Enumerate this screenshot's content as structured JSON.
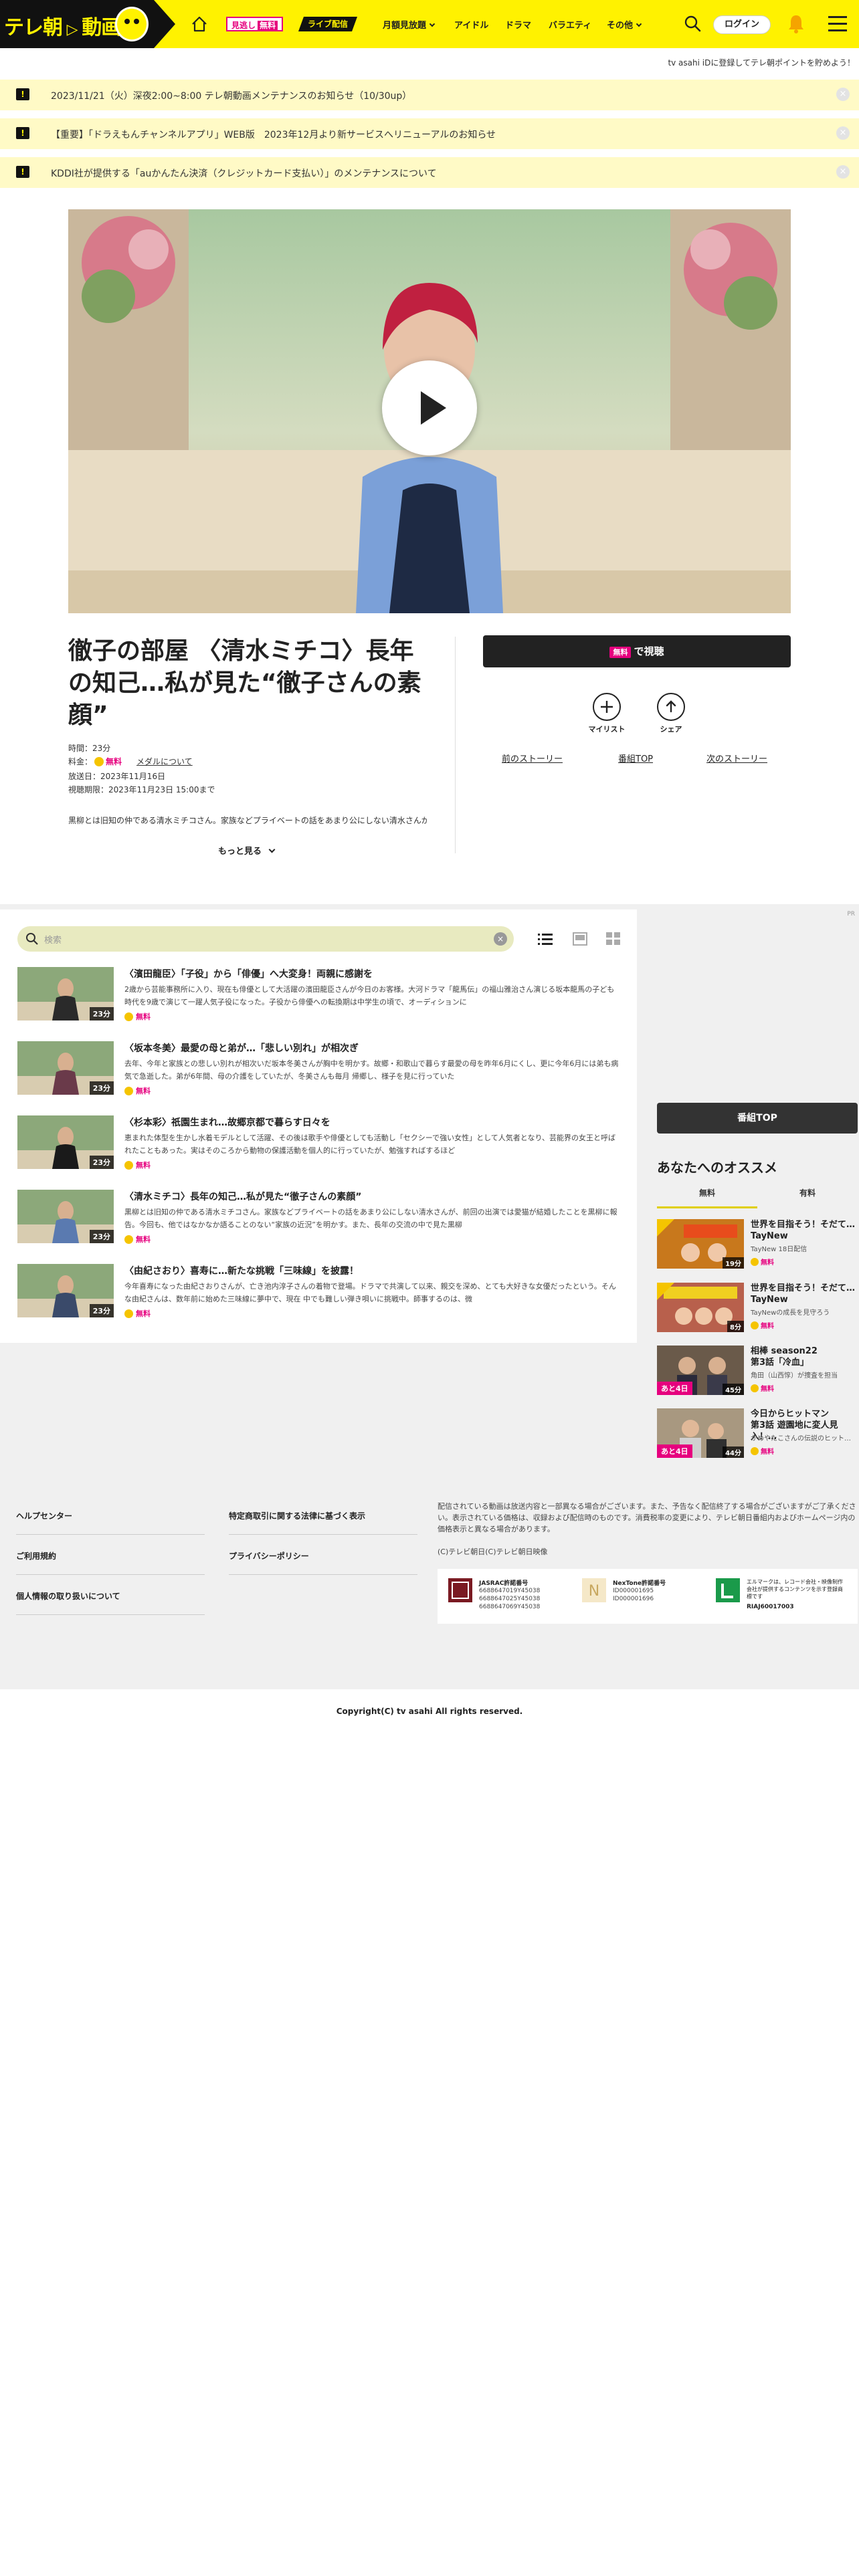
{
  "header": {
    "logo_text": "テレ朝",
    "logo_text2": "動画",
    "badge_mikoshi": "見逃し",
    "badge_free": "無料",
    "badge_live": "ライブ配信",
    "nav": [
      {
        "label": "月額見放題",
        "dropdown": true
      },
      {
        "label": "アイドル",
        "dropdown": false
      },
      {
        "label": "ドラマ",
        "dropdown": false
      },
      {
        "label": "バラエティ",
        "dropdown": false
      },
      {
        "label": "その他",
        "dropdown": true
      }
    ],
    "login_label": "ログイン",
    "brand_yellow": "#fff200"
  },
  "promo_text": "tv asahi iDに登録してテレ朝ポイントを貯めよう！",
  "notices": [
    {
      "icon": "!",
      "text": "2023/11/21（火）深夜2:00~8:00 テレ朝動画メンテナンスのお知らせ（10/30up）",
      "close": "×"
    },
    {
      "icon": "!",
      "text": "【重要】「ドラえもんチャンネルアプリ」WEB版　2023年12月より新サービスへリニューアルのお知らせ",
      "close": "×"
    },
    {
      "icon": "!",
      "text": "KDDI社が提供する「auかんたん決済（クレジットカード支払い）」のメンテナンスについて",
      "close": "×"
    }
  ],
  "episode": {
    "title": "徹子の部屋 〈清水ミチコ〉長年の知己…私が見た“徹子さんの素顔”",
    "time": "時間：23分",
    "price_prefix": "料金：",
    "price_free": "無料",
    "medal_link": "メダルについて",
    "aired": "放送日：2023年11月16日",
    "expires": "視聴期限：2023年11月23日 15:00まで",
    "synopsis": "黒柳とは旧知の仲である清水ミチコさん。家族などプライベートの話をあまり公にしない清水さんが、前回の出演では愛猫が結婚したことを黒柳に報告。",
    "more_label": "もっと見る",
    "watch_tag": "無料",
    "watch_label": "で視聴",
    "mylist_label": "マイリスト",
    "share_label": "シェア",
    "prev_story": "前のストーリー",
    "program_top": "番組TOP",
    "next_story": "次のストーリー"
  },
  "list": {
    "search_placeholder": "検索",
    "items": [
      {
        "title": "〈濱田龍臣〉「子役」から「俳優」へ大変身！両親に感謝を",
        "desc": "2歳から芸能事務所に入り、現在も俳優として大活躍の濱田龍臣さんが今日のお客様。大河ドラマ「龍馬伝」の福山雅治さん演じる坂本龍馬の子ども時代を9歳で演じて一躍人気子役になった。子役から俳優への転換期は中学生の頃で、オーディションに",
        "free": "無料",
        "duration": "23分"
      },
      {
        "title": "〈坂本冬美〉最愛の母と弟が…「悲しい別れ」が相次ぎ",
        "desc": "去年、今年と家族との悲しい別れが相次いだ坂本冬美さんが胸中を明かす。故郷・和歌山で暮らす最愛の母を昨年6月にくし、更に今年6月には弟も病気で急逝した。弟が6年間、母の介護をしていたが、冬美さんも毎月 帰郷し、様子を見に行っていた",
        "free": "無料",
        "duration": "23分"
      },
      {
        "title": "〈杉本彩〉祇園生まれ…故郷京都で暮らす日々を",
        "desc": "恵まれた体型を生かし水着モデルとして活躍、その後は歌手や俳優としても活動し「セクシーで強い女性」として人気者となり、芸能界の女王と呼ばれたこともあった。実はそのころから動物の保護活動を個人的に行っていたが、勉強すればするほど",
        "free": "無料",
        "duration": "23分"
      },
      {
        "title": "〈清水ミチコ〉長年の知己…私が見た“徹子さんの素顔”",
        "desc": "黒柳とは旧知の仲である清水ミチコさん。家族などプライベートの話をあまり公にしない清水さんが、前回の出演では愛猫が結婚したことを黒柳に報告。今回も、他ではなかなか語ることのない“家族の近況”を明かす。また、長年の交流の中で見た黒柳",
        "free": "無料",
        "duration": "23分"
      },
      {
        "title": "〈由紀さおり〉喜寿に…新たな挑戦「三味線」を披露！",
        "desc": "今年喜寿になった由紀さおりさんが、亡き池内淳子さんの着物で登場。ドラマで共演して以来、親交を深め、とても大好きな女優だったという。そんな由紀さんは、数年前に始めた三味線に夢中で、現在 中でも難しい弾き唄いに挑戦中。師事するのは、微",
        "free": "無料",
        "duration": "23分"
      }
    ]
  },
  "sidebar": {
    "pr_label": "PR",
    "program_top_label": "番組TOP",
    "reco_title": "あなたへのオススメ",
    "tab_free": "無料",
    "tab_paid": "有料",
    "items": [
      {
        "title": "世界を目指そう！そだて…",
        "sub": "TayNew",
        "desc": "TayNew 18日配信",
        "free": "無料",
        "duration": "19分",
        "badge": ""
      },
      {
        "title": "世界を目指そう！そだて…",
        "sub": "TayNew",
        "desc": "TayNewの成長を見守ろう",
        "free": "無料",
        "duration": "8分",
        "badge": ""
      },
      {
        "title": "相棒 season22",
        "sub": "第3話「冷血」",
        "desc": "角田（山西惇）が捜査を担当",
        "free": "無料",
        "duration": "45分",
        "badge": "あと4日"
      },
      {
        "title": "今日からヒットマン",
        "sub": "第3話 遊園地に変人見入！…",
        "desc": "かめやたこさんの伝説のヒット…",
        "free": "無料",
        "duration": "44分",
        "badge": "あと4日"
      }
    ]
  },
  "footer": {
    "col1": [
      "ヘルプセンター",
      "ご利用規約",
      "個人情報の取り扱いについて"
    ],
    "col2": [
      "特定商取引に関する法律に基づく表示",
      "プライバシーポリシー"
    ],
    "disclaimer": "配信されている動画は放送内容と一部異なる場合がございます。また、予告なく配信終了する場合がございますがご了承ください。表示されている価格は、収録および配信時のものです。消費税率の変更により、テレビ朝日番組内およびホームページ内の価格表示と異なる場合があります。",
    "copyright_small": "(C)テレビ朝日(C)テレビ朝日映像",
    "jasrac": {
      "title": "JASRAC許諾番号",
      "numbers": [
        "6688647019Y45038",
        "6688647025Y45038",
        "6688647069Y45038"
      ]
    },
    "nextone": {
      "title": "NexTone許諾番号",
      "numbers": [
        "ID000001695",
        "ID000001696"
      ]
    },
    "lmark": {
      "text": "エルマークは、レコード会社・映像制作会社が提供するコンテンツを示す登録商標です",
      "number": "RIAJ60017003"
    },
    "copyright": "Copyright(C) tv asahi All rights reserved."
  }
}
